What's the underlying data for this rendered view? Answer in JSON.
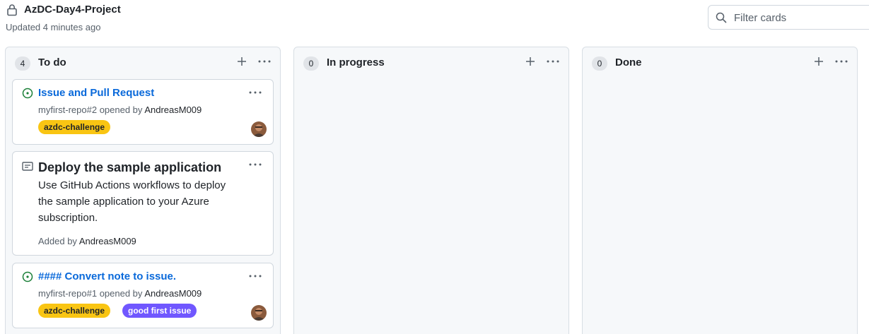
{
  "project": {
    "title": "AzDC-Day4-Project",
    "updated": "Updated 4 minutes ago",
    "filter_placeholder": "Filter cards"
  },
  "columns": [
    {
      "count": "4",
      "name": "To do",
      "cards": [
        {
          "type": "issue",
          "icon": "issue-opened-icon",
          "title": "Issue and Pull Request",
          "ref": "myfirst-repo#2 opened by",
          "author": "AndreasM009",
          "labels": [
            {
              "name": "azdc-challenge",
              "bg": "#f9c513",
              "fg": "#1f2328"
            }
          ]
        },
        {
          "type": "note",
          "icon": "note-icon",
          "title": "Deploy the sample application",
          "body_lines": [
            "Use GitHub Actions workflows to deploy",
            "the sample application to your Azure",
            "subscription."
          ],
          "added_by_label": "Added by",
          "author": "AndreasM009"
        },
        {
          "type": "issue",
          "icon": "issue-opened-icon",
          "title": "#### Convert note to issue.",
          "ref": "myfirst-repo#1 opened by",
          "author": "AndreasM009",
          "labels": [
            {
              "name": "azdc-challenge",
              "bg": "#f9c513",
              "fg": "#1f2328"
            },
            {
              "name": "good first issue",
              "bg": "#7057ff",
              "fg": "#ffffff"
            }
          ]
        }
      ]
    },
    {
      "count": "0",
      "name": "In progress",
      "cards": []
    },
    {
      "count": "0",
      "name": "Done",
      "cards": []
    }
  ],
  "colors": {
    "link": "#0969da",
    "issue_open": "#1a7f37",
    "muted": "#57606a"
  }
}
